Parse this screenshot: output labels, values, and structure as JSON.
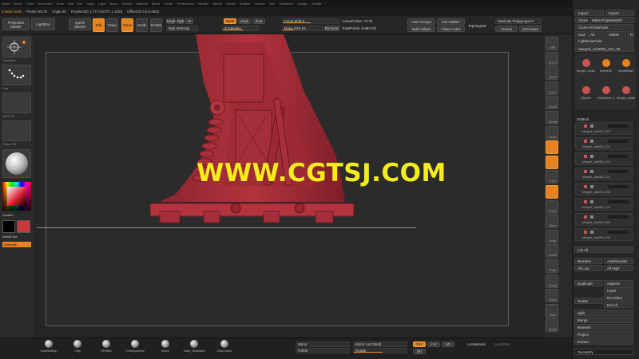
{
  "menu": [
    "Alpha",
    "Brush",
    "Color",
    "Document",
    "Draw",
    "Edit",
    "File",
    "Layer",
    "Light",
    "Macro",
    "Marker",
    "Material",
    "Movie",
    "Picker",
    "Preferences",
    "Render",
    "Stencil",
    "Stroke",
    "Surface",
    "Texture",
    "Tool",
    "Transform",
    "Zplugin",
    "Zscript"
  ],
  "status": {
    "units": "0.6492 Units",
    "pixels": "Pixels 00175",
    "angle": "Angle 40",
    "position": "Position3D 1.777,5.6707,1.3183",
    "offset": "Offset3D 0,0,0.6952"
  },
  "toolbar": {
    "projection_master": "Projection Master",
    "lightbox": "LightBox",
    "quick_sketch": "Quick Sketch",
    "edit": "Edit",
    "draw": "Draw",
    "move": "Move",
    "scale": "Scale",
    "rotate": "Rotate",
    "mrgb": "Mrgb",
    "rgb": "Rgb",
    "m": "M",
    "zadd": "Zadd",
    "zsub": "Zsub",
    "zcut": "Zcut",
    "rgb_intensity": "Rgb Intensity",
    "z_intensity": "Z Intensity",
    "focal_shift": "Focal Shift 0",
    "draw_size": "Draw Size 64",
    "dynamic": "Dynamic",
    "active_points": "ActivePoints: 73.7k",
    "total_points": "TotalPoints: 6.883 Mil",
    "auto_groups": "Auto Groups",
    "split_hidden": "Split Hidden",
    "del_hidden": "Del Hidden",
    "close_holes": "Close Holes",
    "topological": "Topological",
    "mask_by_polygroups": "Mask By Polygroups 0",
    "crease": "Crease",
    "uncrease": "UnCrease"
  },
  "left": {
    "transpose": "Transpose",
    "dots": "Dots",
    "alpha_off": "Alpha Off",
    "texture_off": "Texture Off",
    "material": "Material",
    "gradient": "Gradient",
    "switch_color": "SwitchColor",
    "alternate": "Alternate"
  },
  "right_shelf": [
    "BPR",
    "SPix 3",
    "Scroll",
    "Zoom",
    "Actual",
    "AAHalf",
    "Persp",
    "Floor",
    "Local",
    "L.Sym",
    "Xyz",
    "Frame",
    "Move",
    "Scale",
    "Rotate",
    "PolyF",
    "Transp",
    "Ghost",
    "Solo",
    "Xpose"
  ],
  "bottom": {
    "brushes": [
      "ClayBuildup",
      "Clay",
      "hPolish",
      "TrimDynamic",
      "Move",
      "Dam_Standard",
      "ClayTubes"
    ],
    "mirror": "Mirror",
    "mirror_and_weld": "Mirror And Weld",
    "polish": "Polish",
    "rotate": "Rotate",
    "size_sym": ">X<",
    "ysym": ">Y<",
    "zsym": ">Z<",
    "r": "(R)",
    "lazymouse": "LazyMouse",
    "lazystep": "LazyStep"
  },
  "panel": {
    "import": "Import",
    "export": "Export",
    "clone": "Clone",
    "make_polymesh": "Make PolyMesh3D",
    "clone_all_subtools": "Clone All SubTools",
    "goz": "GoZ",
    "all": "All",
    "visible": "Visible",
    "r": "R",
    "lightbox_tools": "Lightbox▸Tools",
    "current_tool": "Merged_Joint004_012_49",
    "tool_names": [
      "Merged_Joint004_",
      "Sphere3D",
      "SimpleBrush",
      "ZSphere",
      "PolySphere_1",
      "Merged_Joint004_"
    ],
    "subtool": "Subtool",
    "subtools": [
      "Merged_Joint004_024",
      "Merged_Joint004_014",
      "Merged_Joint004_013",
      "Merged_Joint004_012",
      "Merged_Joint004_018",
      "Merged_Joint004_019",
      "Merged_Joint004_020",
      "Merged_Joint004_010"
    ],
    "list_all": "List All",
    "rename": "Rename",
    "autoreorder": "AutoReorder",
    "all_low": "All Low",
    "all_high": "All High",
    "duplicate": "Duplicate",
    "append": "Append",
    "insert": "Insert",
    "delete": "Delete",
    "del_other": "Del Other",
    "del_all": "Del All",
    "split": "Split",
    "merge": "Merge",
    "remesh": "Remesh",
    "project": "Project",
    "extract": "Extract",
    "geometry": "Geometry"
  },
  "watermark": "WWW.CGTSJ.COM",
  "colors": {
    "accent": "#e8821f",
    "model": "#b2333d",
    "watermark": "#f4ec1b"
  }
}
